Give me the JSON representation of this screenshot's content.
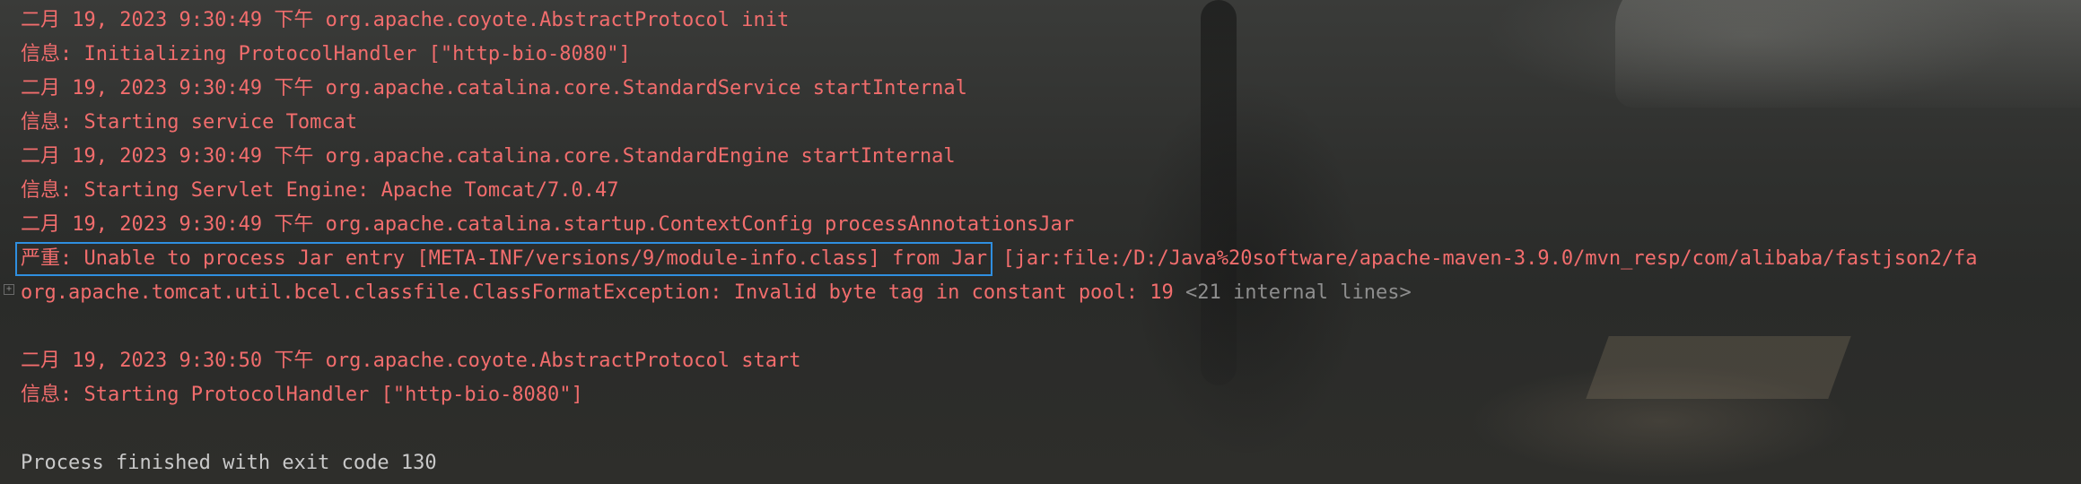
{
  "console": {
    "lines": [
      {
        "text": "二月 19, 2023 9:30:49 下午 org.apache.coyote.AbstractProtocol init"
      },
      {
        "text": "信息: Initializing ProtocolHandler [\"http-bio-8080\"]"
      },
      {
        "text": "二月 19, 2023 9:30:49 下午 org.apache.catalina.core.StandardService startInternal"
      },
      {
        "text": "信息: Starting service Tomcat"
      },
      {
        "text": "二月 19, 2023 9:30:49 下午 org.apache.catalina.core.StandardEngine startInternal"
      },
      {
        "text": "信息: Starting Servlet Engine: Apache Tomcat/7.0.47"
      },
      {
        "text": "二月 19, 2023 9:30:49 下午 org.apache.catalina.startup.ContextConfig processAnnotationsJar"
      },
      {
        "highlighted": "严重: Unable to process Jar entry [META-INF/versions/9/module-info.class] from Jar",
        "rest": " [jar:file:/D:/Java%20software/apache-maven-3.9.0/mvn_resp/com/alibaba/fastjson2/fa"
      },
      {
        "text": "org.apache.tomcat.util.bcel.classfile.ClassFormatException: Invalid byte tag in constant pool: 19 ",
        "fold": "<21 internal lines>"
      },
      {
        "text": ""
      },
      {
        "text": "二月 19, 2023 9:30:50 下午 org.apache.coyote.AbstractProtocol start"
      },
      {
        "text": "信息: Starting ProtocolHandler [\"http-bio-8080\"]"
      },
      {
        "text": ""
      },
      {
        "text": "Process finished with exit code 130"
      }
    ]
  },
  "colors": {
    "error_text": "#f26d6d",
    "normal_text": "#c9c9c9",
    "muted_text": "#8e8e8e",
    "selection_border": "#2f8fe0"
  },
  "icons": {
    "fold_marker": "fold-expand-icon"
  }
}
